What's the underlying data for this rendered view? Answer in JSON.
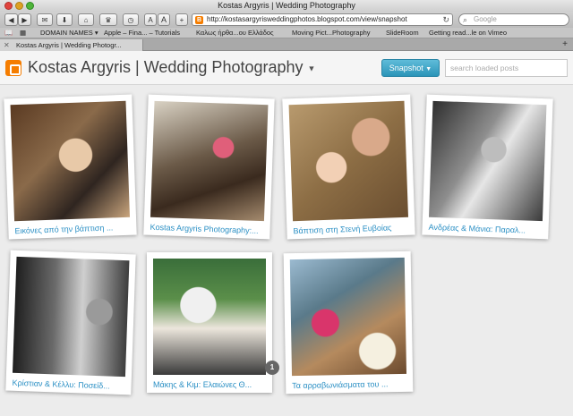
{
  "window": {
    "title": "Kostas Argyris | Wedding Photography"
  },
  "toolbar": {
    "url": "http://kostasargyrisweddingphotos.blogspot.com/view/snapshot",
    "search_placeholder": "Google",
    "zoom_small": "A",
    "zoom_large": "A",
    "add_label": "+"
  },
  "bookmarks": [
    "DOMAIN NAMES ▾",
    "Apple – Fina... – Tutorials",
    "Καλως ήρθα...ου Ελλάδος",
    "Moving Pict...Photography",
    "SlideRoom",
    "Getting read...le on Vimeo"
  ],
  "tab": {
    "label": "Kostas Argyris | Wedding Photogr..."
  },
  "blog": {
    "title": "Kostas Argyris | Wedding Photography",
    "snapshot_label": "Snapshot",
    "search_placeholder": "search loaded posts"
  },
  "posts": [
    {
      "caption": "Εικόνες από την βάπτιση ..."
    },
    {
      "caption": "Kostas Argyris Photography:..."
    },
    {
      "caption": "Βάπτιση στη Στενή Ευβοίας"
    },
    {
      "caption": "Ανδρέας & Μάνια: Παραλ..."
    },
    {
      "caption": "Κρίστιαν & Κέλλυ: Ποσείδ..."
    },
    {
      "caption": "Μάκης & Κιμ: Ελαιώνες Θ..."
    },
    {
      "caption": "Τα αρραβωνιάσματα του ..."
    }
  ],
  "badge_count": "1"
}
